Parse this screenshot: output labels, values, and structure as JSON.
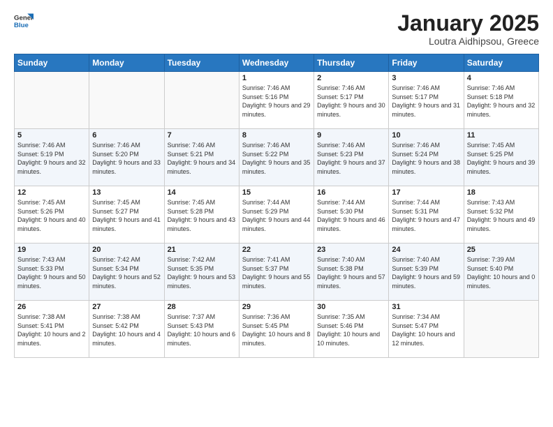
{
  "logo": {
    "general": "General",
    "blue": "Blue"
  },
  "header": {
    "title": "January 2025",
    "subtitle": "Loutra Aidhipsou, Greece"
  },
  "weekdays": [
    "Sunday",
    "Monday",
    "Tuesday",
    "Wednesday",
    "Thursday",
    "Friday",
    "Saturday"
  ],
  "weeks": [
    [
      {
        "day": "",
        "sunrise": "",
        "sunset": "",
        "daylight": ""
      },
      {
        "day": "",
        "sunrise": "",
        "sunset": "",
        "daylight": ""
      },
      {
        "day": "",
        "sunrise": "",
        "sunset": "",
        "daylight": ""
      },
      {
        "day": "1",
        "sunrise": "Sunrise: 7:46 AM",
        "sunset": "Sunset: 5:16 PM",
        "daylight": "Daylight: 9 hours and 29 minutes."
      },
      {
        "day": "2",
        "sunrise": "Sunrise: 7:46 AM",
        "sunset": "Sunset: 5:17 PM",
        "daylight": "Daylight: 9 hours and 30 minutes."
      },
      {
        "day": "3",
        "sunrise": "Sunrise: 7:46 AM",
        "sunset": "Sunset: 5:17 PM",
        "daylight": "Daylight: 9 hours and 31 minutes."
      },
      {
        "day": "4",
        "sunrise": "Sunrise: 7:46 AM",
        "sunset": "Sunset: 5:18 PM",
        "daylight": "Daylight: 9 hours and 32 minutes."
      }
    ],
    [
      {
        "day": "5",
        "sunrise": "Sunrise: 7:46 AM",
        "sunset": "Sunset: 5:19 PM",
        "daylight": "Daylight: 9 hours and 32 minutes."
      },
      {
        "day": "6",
        "sunrise": "Sunrise: 7:46 AM",
        "sunset": "Sunset: 5:20 PM",
        "daylight": "Daylight: 9 hours and 33 minutes."
      },
      {
        "day": "7",
        "sunrise": "Sunrise: 7:46 AM",
        "sunset": "Sunset: 5:21 PM",
        "daylight": "Daylight: 9 hours and 34 minutes."
      },
      {
        "day": "8",
        "sunrise": "Sunrise: 7:46 AM",
        "sunset": "Sunset: 5:22 PM",
        "daylight": "Daylight: 9 hours and 35 minutes."
      },
      {
        "day": "9",
        "sunrise": "Sunrise: 7:46 AM",
        "sunset": "Sunset: 5:23 PM",
        "daylight": "Daylight: 9 hours and 37 minutes."
      },
      {
        "day": "10",
        "sunrise": "Sunrise: 7:46 AM",
        "sunset": "Sunset: 5:24 PM",
        "daylight": "Daylight: 9 hours and 38 minutes."
      },
      {
        "day": "11",
        "sunrise": "Sunrise: 7:45 AM",
        "sunset": "Sunset: 5:25 PM",
        "daylight": "Daylight: 9 hours and 39 minutes."
      }
    ],
    [
      {
        "day": "12",
        "sunrise": "Sunrise: 7:45 AM",
        "sunset": "Sunset: 5:26 PM",
        "daylight": "Daylight: 9 hours and 40 minutes."
      },
      {
        "day": "13",
        "sunrise": "Sunrise: 7:45 AM",
        "sunset": "Sunset: 5:27 PM",
        "daylight": "Daylight: 9 hours and 41 minutes."
      },
      {
        "day": "14",
        "sunrise": "Sunrise: 7:45 AM",
        "sunset": "Sunset: 5:28 PM",
        "daylight": "Daylight: 9 hours and 43 minutes."
      },
      {
        "day": "15",
        "sunrise": "Sunrise: 7:44 AM",
        "sunset": "Sunset: 5:29 PM",
        "daylight": "Daylight: 9 hours and 44 minutes."
      },
      {
        "day": "16",
        "sunrise": "Sunrise: 7:44 AM",
        "sunset": "Sunset: 5:30 PM",
        "daylight": "Daylight: 9 hours and 46 minutes."
      },
      {
        "day": "17",
        "sunrise": "Sunrise: 7:44 AM",
        "sunset": "Sunset: 5:31 PM",
        "daylight": "Daylight: 9 hours and 47 minutes."
      },
      {
        "day": "18",
        "sunrise": "Sunrise: 7:43 AM",
        "sunset": "Sunset: 5:32 PM",
        "daylight": "Daylight: 9 hours and 49 minutes."
      }
    ],
    [
      {
        "day": "19",
        "sunrise": "Sunrise: 7:43 AM",
        "sunset": "Sunset: 5:33 PM",
        "daylight": "Daylight: 9 hours and 50 minutes."
      },
      {
        "day": "20",
        "sunrise": "Sunrise: 7:42 AM",
        "sunset": "Sunset: 5:34 PM",
        "daylight": "Daylight: 9 hours and 52 minutes."
      },
      {
        "day": "21",
        "sunrise": "Sunrise: 7:42 AM",
        "sunset": "Sunset: 5:35 PM",
        "daylight": "Daylight: 9 hours and 53 minutes."
      },
      {
        "day": "22",
        "sunrise": "Sunrise: 7:41 AM",
        "sunset": "Sunset: 5:37 PM",
        "daylight": "Daylight: 9 hours and 55 minutes."
      },
      {
        "day": "23",
        "sunrise": "Sunrise: 7:40 AM",
        "sunset": "Sunset: 5:38 PM",
        "daylight": "Daylight: 9 hours and 57 minutes."
      },
      {
        "day": "24",
        "sunrise": "Sunrise: 7:40 AM",
        "sunset": "Sunset: 5:39 PM",
        "daylight": "Daylight: 9 hours and 59 minutes."
      },
      {
        "day": "25",
        "sunrise": "Sunrise: 7:39 AM",
        "sunset": "Sunset: 5:40 PM",
        "daylight": "Daylight: 10 hours and 0 minutes."
      }
    ],
    [
      {
        "day": "26",
        "sunrise": "Sunrise: 7:38 AM",
        "sunset": "Sunset: 5:41 PM",
        "daylight": "Daylight: 10 hours and 2 minutes."
      },
      {
        "day": "27",
        "sunrise": "Sunrise: 7:38 AM",
        "sunset": "Sunset: 5:42 PM",
        "daylight": "Daylight: 10 hours and 4 minutes."
      },
      {
        "day": "28",
        "sunrise": "Sunrise: 7:37 AM",
        "sunset": "Sunset: 5:43 PM",
        "daylight": "Daylight: 10 hours and 6 minutes."
      },
      {
        "day": "29",
        "sunrise": "Sunrise: 7:36 AM",
        "sunset": "Sunset: 5:45 PM",
        "daylight": "Daylight: 10 hours and 8 minutes."
      },
      {
        "day": "30",
        "sunrise": "Sunrise: 7:35 AM",
        "sunset": "Sunset: 5:46 PM",
        "daylight": "Daylight: 10 hours and 10 minutes."
      },
      {
        "day": "31",
        "sunrise": "Sunrise: 7:34 AM",
        "sunset": "Sunset: 5:47 PM",
        "daylight": "Daylight: 10 hours and 12 minutes."
      },
      {
        "day": "",
        "sunrise": "",
        "sunset": "",
        "daylight": ""
      }
    ]
  ]
}
